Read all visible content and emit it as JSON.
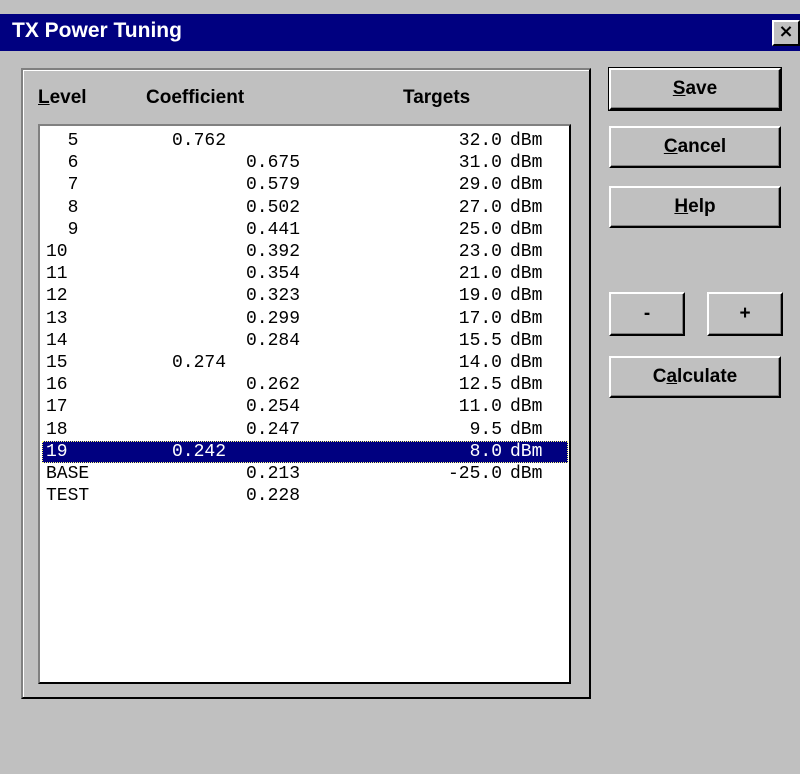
{
  "window": {
    "title": "TX Power Tuning",
    "close_glyph": "×"
  },
  "columns": {
    "level": "Level",
    "coefficient": "Coefficient",
    "targets": "Targets"
  },
  "rows": [
    {
      "level": "5",
      "coefficient": "0.762",
      "target": "32.0",
      "unit": "dBm",
      "coef_align": "left"
    },
    {
      "level": "6",
      "coefficient": "0.675",
      "target": "31.0",
      "unit": "dBm",
      "coef_align": "right"
    },
    {
      "level": "7",
      "coefficient": "0.579",
      "target": "29.0",
      "unit": "dBm",
      "coef_align": "right"
    },
    {
      "level": "8",
      "coefficient": "0.502",
      "target": "27.0",
      "unit": "dBm",
      "coef_align": "right"
    },
    {
      "level": "9",
      "coefficient": "0.441",
      "target": "25.0",
      "unit": "dBm",
      "coef_align": "right"
    },
    {
      "level": "10",
      "coefficient": "0.392",
      "target": "23.0",
      "unit": "dBm",
      "coef_align": "right"
    },
    {
      "level": "11",
      "coefficient": "0.354",
      "target": "21.0",
      "unit": "dBm",
      "coef_align": "right"
    },
    {
      "level": "12",
      "coefficient": "0.323",
      "target": "19.0",
      "unit": "dBm",
      "coef_align": "right"
    },
    {
      "level": "13",
      "coefficient": "0.299",
      "target": "17.0",
      "unit": "dBm",
      "coef_align": "right"
    },
    {
      "level": "14",
      "coefficient": "0.284",
      "target": "15.5",
      "unit": "dBm",
      "coef_align": "right"
    },
    {
      "level": "15",
      "coefficient": "0.274",
      "target": "14.0",
      "unit": "dBm",
      "coef_align": "left"
    },
    {
      "level": "16",
      "coefficient": "0.262",
      "target": "12.5",
      "unit": "dBm",
      "coef_align": "right"
    },
    {
      "level": "17",
      "coefficient": "0.254",
      "target": "11.0",
      "unit": "dBm",
      "coef_align": "right"
    },
    {
      "level": "18",
      "coefficient": "0.247",
      "target": "9.5",
      "unit": "dBm",
      "coef_align": "right"
    },
    {
      "level": "19",
      "coefficient": "0.242",
      "target": "8.0",
      "unit": "dBm",
      "coef_align": "left",
      "selected": true
    },
    {
      "level": "BASE",
      "coefficient": "0.213",
      "target": "-25.0",
      "unit": "dBm",
      "coef_align": "right"
    },
    {
      "level": "TEST",
      "coefficient": "0.228",
      "target": "",
      "unit": "",
      "coef_align": "right"
    }
  ],
  "buttons": {
    "save": "Save",
    "cancel": "Cancel",
    "help": "Help",
    "minus": "-",
    "plus": "+",
    "calculate": "Calculate"
  },
  "colors": {
    "titlebar": "#000080",
    "face": "#c0c0c0",
    "selection": "#000080"
  }
}
